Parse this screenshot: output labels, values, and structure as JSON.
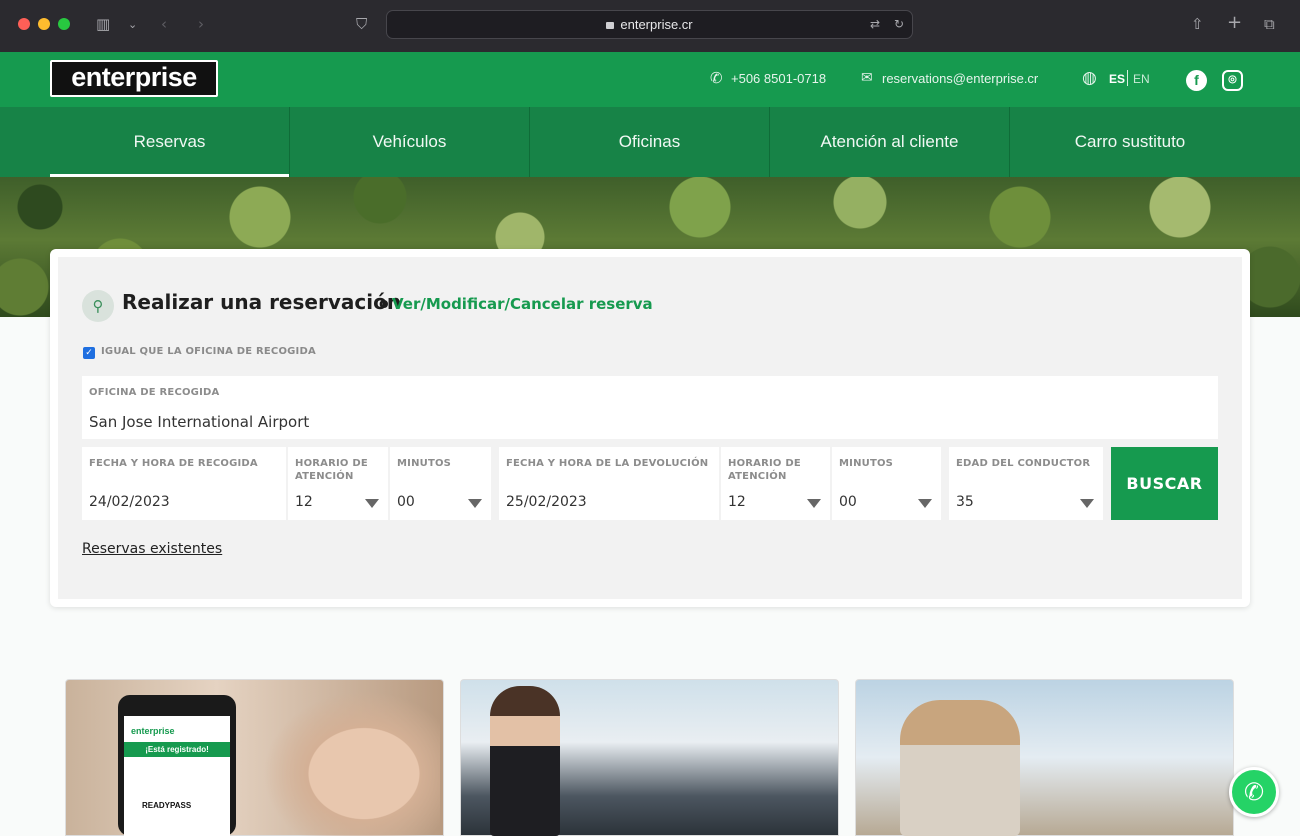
{
  "browser": {
    "url": "enterprise.cr"
  },
  "header": {
    "logo_text": "enterprise",
    "phone": "+506 8501-0718",
    "email": "reservations@enterprise.cr",
    "lang_active": "ES",
    "lang_other": "EN",
    "social": {
      "facebook": "f",
      "instagram": "◎"
    }
  },
  "nav": {
    "tabs": [
      {
        "label": "Reservas"
      },
      {
        "label": "Vehículos"
      },
      {
        "label": "Oficinas"
      },
      {
        "label": "Atención al cliente"
      },
      {
        "label": "Carro sustituto"
      }
    ]
  },
  "booking": {
    "title": "Realizar una reservación",
    "or": "o",
    "manage_link": "Ver/Modificar/Cancelar reserva",
    "same_office_label": "IGUAL QUE LA OFICINA DE RECOGIDA",
    "same_office_checked": true,
    "pickup_office": {
      "label": "OFICINA DE RECOGIDA",
      "value": "San Jose International Airport"
    },
    "pickup_date": {
      "label": "FECHA Y HORA DE RECOGIDA",
      "value": "24/02/2023"
    },
    "pickup_hour": {
      "label": "HORARIO DE ATENCIÓN",
      "value": "12"
    },
    "pickup_minutes": {
      "label": "MINUTOS",
      "value": "00"
    },
    "return_date": {
      "label": "FECHA Y HORA DE LA DEVOLUCIÓN",
      "value": "25/02/2023"
    },
    "return_hour": {
      "label": "HORARIO DE ATENCIÓN",
      "value": "12"
    },
    "return_minutes": {
      "label": "MINUTOS",
      "value": "00"
    },
    "driver_age": {
      "label": "EDAD DEL CONDUCTOR",
      "value": "35"
    },
    "search_button": "BUSCAR",
    "existing_link": "Reservas existentes"
  },
  "promos": {
    "phone_logo": "enterprise",
    "phone_banner": "¡Está registrado!",
    "phone_readypass": "READYPASS"
  },
  "colors": {
    "brand_green": "#169a4f",
    "nav_green": "#178347"
  }
}
